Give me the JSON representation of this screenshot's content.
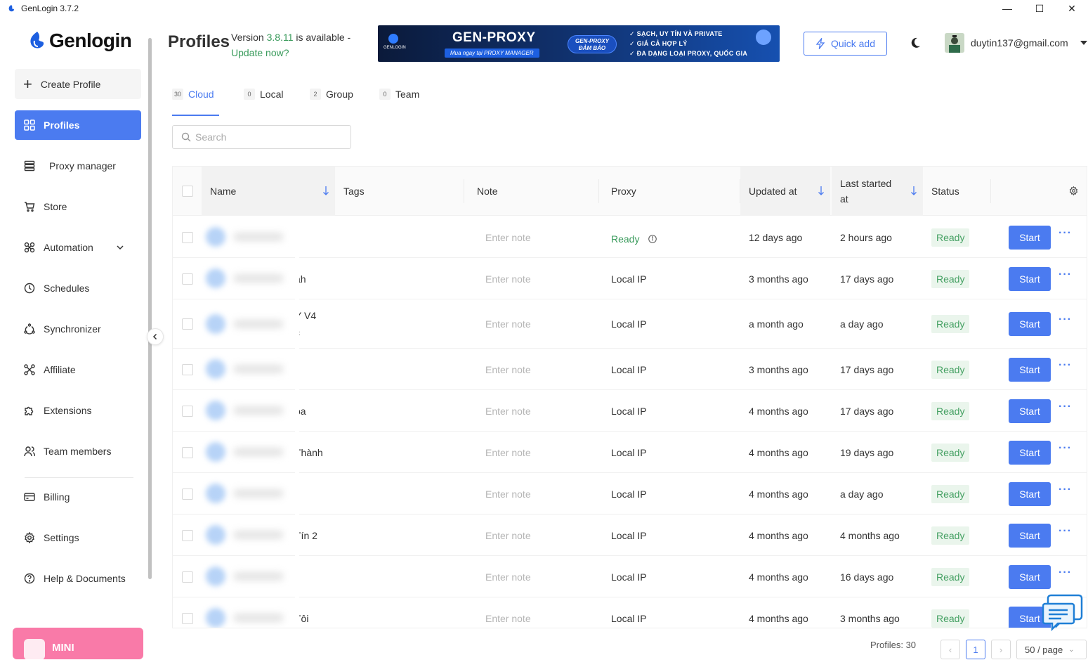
{
  "window": {
    "title": "GenLogin 3.7.2"
  },
  "brand": {
    "name": "Genlogin",
    "accent": "#4b7bf0"
  },
  "sidebar": {
    "create_label": "Create Profile",
    "items": [
      {
        "label": "Profiles",
        "icon": "grid-icon",
        "active": true
      },
      {
        "label": "Proxy manager",
        "icon": "server-icon"
      },
      {
        "label": "Store",
        "icon": "cart-icon"
      },
      {
        "label": "Automation",
        "icon": "automation-icon"
      },
      {
        "label": "Schedules",
        "icon": "clock-icon"
      },
      {
        "label": "Synchronizer",
        "icon": "sync-icon"
      },
      {
        "label": "Affiliate",
        "icon": "affiliate-icon"
      },
      {
        "label": "Extensions",
        "icon": "puzzle-icon"
      },
      {
        "label": "Team members",
        "icon": "users-icon"
      },
      {
        "label": "Billing",
        "icon": "card-icon"
      },
      {
        "label": "Settings",
        "icon": "gear-icon"
      },
      {
        "label": "Help & Documents",
        "icon": "help-icon"
      }
    ],
    "mini_label": "MINI"
  },
  "header": {
    "title": "Profiles",
    "version_prefix": "Version ",
    "version_number": "3.8.11",
    "version_suffix": " is available -",
    "update_link": "Update now?",
    "quick_add": "Quick add",
    "user_email": "duytin137@gmail.com"
  },
  "banner": {
    "logo_text": "GENLOGIN",
    "title": "GEN-PROXY",
    "subtitle": "Mua ngay tại PROXY MANAGER",
    "badge": "GEN-PROXY ĐẢM BẢO",
    "features": [
      "SẠCH, UY TÍN VÀ PRIVATE",
      "GIÁ CẢ HỢP LÝ",
      "ĐA DẠNG LOẠI PROXY, QUỐC GIA"
    ]
  },
  "tabs": [
    {
      "count": "30",
      "label": "Cloud",
      "active": true
    },
    {
      "count": "0",
      "label": "Local"
    },
    {
      "count": "2",
      "label": "Group"
    },
    {
      "count": "0",
      "label": "Team"
    }
  ],
  "search": {
    "placeholder": "Search"
  },
  "table": {
    "columns": {
      "name": "Name",
      "tags": "Tags",
      "note": "Note",
      "proxy": "Proxy",
      "updated": "Updated at",
      "last_started": "Last started",
      "last_started_2": "at",
      "status": "Status"
    },
    "rows": [
      {
        "name_suffix": "",
        "name_suffix_2": "",
        "note": "Enter note",
        "proxy": "Ready",
        "updated": "12 days ago",
        "last": "2 hours ago",
        "status": "Ready",
        "action": "Start"
      },
      {
        "name_suffix": "ah",
        "name_suffix_2": "",
        "note": "Enter note",
        "proxy": "Local IP",
        "updated": "3 months ago",
        "last": "17 days ago",
        "status": "Ready",
        "action": "Start"
      },
      {
        "name_suffix": "Y V4",
        "name_suffix_2": "c",
        "note": "Enter note",
        "proxy": "Local IP",
        "updated": "a month ago",
        "last": "a day ago",
        "status": "Ready",
        "action": "Start"
      },
      {
        "name_suffix": "",
        "name_suffix_2": "",
        "note": "Enter note",
        "proxy": "Local IP",
        "updated": "3 months ago",
        "last": "17 days ago",
        "status": "Ready",
        "action": "Start"
      },
      {
        "name_suffix": "oa",
        "name_suffix_2": "",
        "note": "Enter note",
        "proxy": "Local IP",
        "updated": "4 months ago",
        "last": "17 days ago",
        "status": "Ready",
        "action": "Start"
      },
      {
        "name_suffix": "Thành",
        "name_suffix_2": "",
        "note": "Enter note",
        "proxy": "Local IP",
        "updated": "4 months ago",
        "last": "19 days ago",
        "status": "Ready",
        "action": "Start"
      },
      {
        "name_suffix": "",
        "name_suffix_2": "",
        "note": "Enter note",
        "proxy": "Local IP",
        "updated": "4 months ago",
        "last": "a day ago",
        "status": "Ready",
        "action": "Start"
      },
      {
        "name_suffix": "Tín 2",
        "name_suffix_2": "",
        "note": "Enter note",
        "proxy": "Local IP",
        "updated": "4 months ago",
        "last": "4 months ago",
        "status": "Ready",
        "action": "Start"
      },
      {
        "name_suffix": "",
        "name_suffix_2": "",
        "note": "Enter note",
        "proxy": "Local IP",
        "updated": "4 months ago",
        "last": "16 days ago",
        "status": "Ready",
        "action": "Start"
      },
      {
        "name_suffix": "Tôi",
        "name_suffix_2": "",
        "note": "Enter note",
        "proxy": "Local IP",
        "updated": "4 months ago",
        "last": "3 months ago",
        "status": "Ready",
        "action": "Start"
      }
    ]
  },
  "footer": {
    "profiles_count": "Profiles: 30",
    "current_page": "1",
    "page_size": "50 / page"
  }
}
